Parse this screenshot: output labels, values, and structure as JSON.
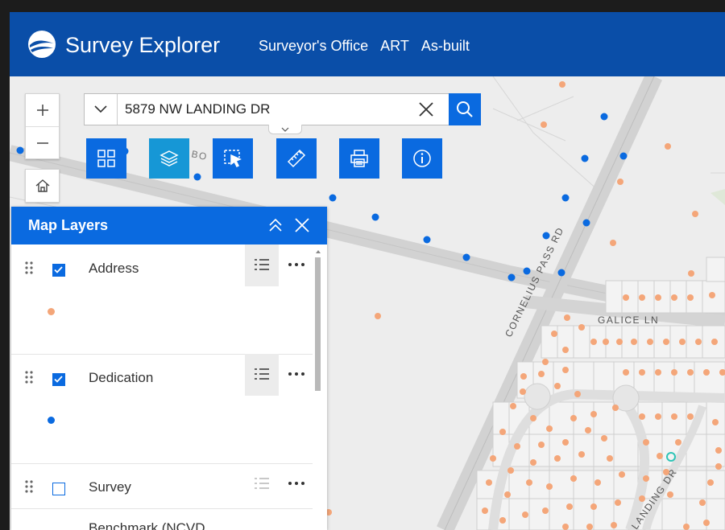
{
  "app": {
    "title": "Survey Explorer",
    "nav": [
      "Surveyor's Office",
      "ART",
      "As-built"
    ]
  },
  "search": {
    "value": "5879 NW LANDING DR"
  },
  "map": {
    "streets": [
      "CORNELIUS PASS RD",
      "GALICE LN",
      "LANDING DR"
    ],
    "partial_label": "BO"
  },
  "tools": [
    "grid-icon",
    "layers-icon",
    "select-icon",
    "measure-icon",
    "print-icon",
    "info-icon"
  ],
  "panel": {
    "title": "Map Layers",
    "layers": [
      {
        "name": "Address",
        "checked": true,
        "swatch": "#f4a679"
      },
      {
        "name": "Dedication",
        "checked": true,
        "swatch": "#0a6ae0"
      },
      {
        "name": "Survey",
        "checked": false
      },
      {
        "name": "Benchmark (NCVD"
      }
    ]
  },
  "colors": {
    "header": "#0a4ea8",
    "accent": "#0a6ae0",
    "address_point": "#f4a679",
    "dedication_point": "#0a6ae0"
  }
}
